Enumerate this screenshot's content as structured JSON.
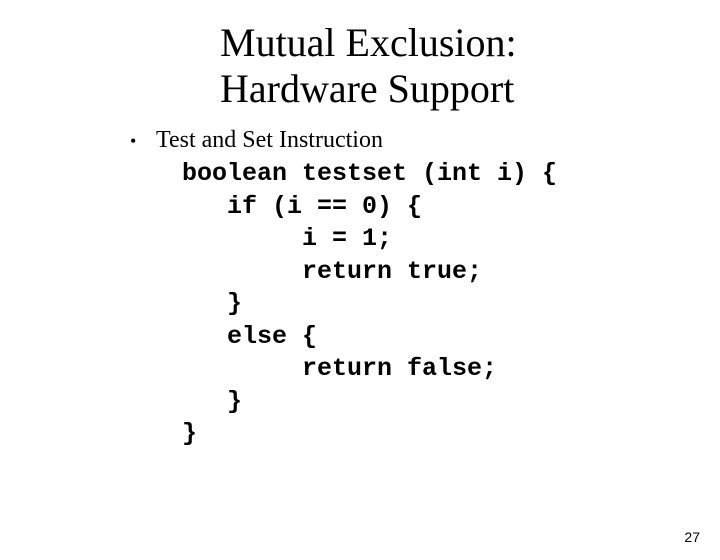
{
  "title_line1": "Mutual Exclusion:",
  "title_line2": "Hardware Support",
  "bullet_text": "Test and Set Instruction",
  "code": "boolean testset (int i) {\n   if (i == 0) {\n        i = 1;\n        return true;\n   }\n   else {\n        return false;\n   }\n}",
  "page_number": "27"
}
